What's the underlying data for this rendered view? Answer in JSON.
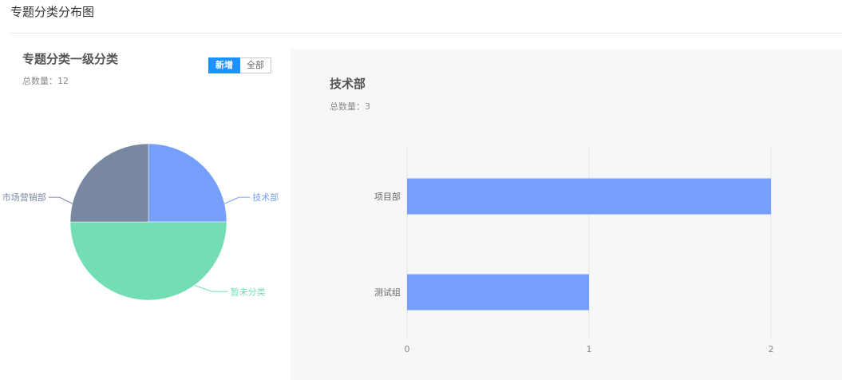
{
  "page": {
    "title": "专题分类分布图"
  },
  "left_panel": {
    "title": "专题分类一级分类",
    "subtitle": "总数量：12",
    "toggle": {
      "active_label": "新增",
      "other_label": "全部"
    }
  },
  "right_panel": {
    "title": "技术部",
    "subtitle": "总数量：3"
  },
  "colors": {
    "blue": "#759ffb",
    "green": "#73ddb4",
    "slate": "#7888a1",
    "accent": "#1e90ff"
  },
  "chart_data": [
    {
      "type": "pie",
      "title": "专题分类一级分类",
      "slices": [
        {
          "label": "技术部",
          "value": 3,
          "color": "#759ffb"
        },
        {
          "label": "暂未分类",
          "value": 6,
          "color": "#73ddb4"
        },
        {
          "label": "市场营销部",
          "value": 3,
          "color": "#7888a1"
        }
      ]
    },
    {
      "type": "bar",
      "orientation": "horizontal",
      "title": "技术部",
      "categories": [
        "项目部",
        "测试组"
      ],
      "values": [
        2,
        1
      ],
      "xlim": [
        0,
        2
      ],
      "xticks": [
        0,
        1,
        2
      ],
      "grid": true,
      "color": "#759ffb"
    }
  ]
}
